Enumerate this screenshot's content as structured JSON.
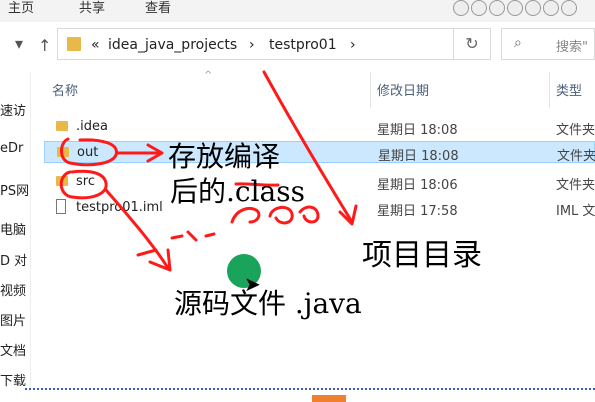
{
  "ribbon": {
    "tabs": [
      "主页",
      "共享",
      "查看"
    ]
  },
  "navigation": {
    "back_icon": "left-arrow",
    "up_icon": "up-arrow",
    "breadcrumb": [
      "idea_java_projects",
      "testpro01"
    ],
    "chevron_left": "«",
    "separator": "›",
    "search_placeholder": "搜索\"",
    "refresh_icon": "refresh"
  },
  "sidebar": {
    "items": [
      "速访",
      "eDr",
      "PS网",
      "电脑",
      "D 对",
      "视频",
      "图片",
      "文档",
      "下载"
    ]
  },
  "columns": {
    "name": "名称",
    "date": "修改日期",
    "type": "类型"
  },
  "files": [
    {
      "name": ".idea",
      "date": "星期日 18:08",
      "type": "文件夹",
      "icon": "folder-icon",
      "selected": false
    },
    {
      "name": "out",
      "date": "星期日 18:08",
      "type": "文件夹",
      "icon": "folder-icon",
      "selected": true
    },
    {
      "name": "src",
      "date": "星期日 18:06",
      "type": "文件夹",
      "icon": "folder-icon",
      "selected": false
    },
    {
      "name": "testpro01.iml",
      "date": "星期日 17:58",
      "type": "IML 文",
      "icon": "file-icon",
      "selected": false
    }
  ],
  "annotations": {
    "out_note_line1": "存放编译",
    "out_note_line2": "后的.class",
    "src_note": "源码文件 .java",
    "project_note": "项目目录",
    "ink_color": "#ff1a1a"
  }
}
